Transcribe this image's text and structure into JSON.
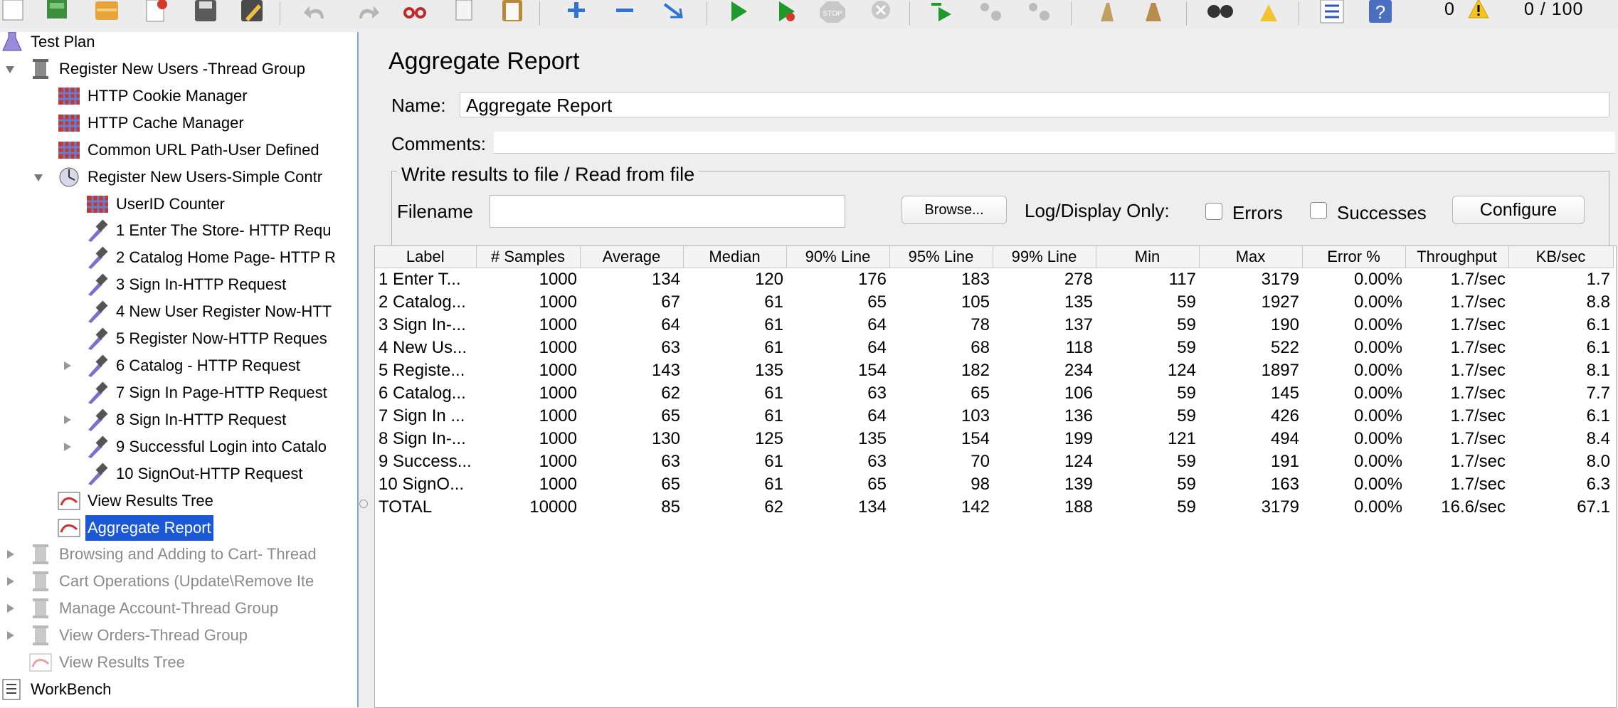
{
  "toolbar": {
    "error_count": "0",
    "thread_status": "0 / 100",
    "buttons": [
      "new-icon",
      "templates-icon",
      "open-icon",
      "close-icon",
      "save-icon",
      "save-as-icon",
      "undo-icon",
      "redo-icon",
      "cut-icon",
      "copy-icon",
      "paste-icon",
      "expand-icon",
      "collapse-icon",
      "toggle-icon",
      "start-icon",
      "start-no-pauses-icon",
      "stop-icon",
      "shutdown-icon",
      "remote-start-icon",
      "remote-stop-icon",
      "remote-shutdown-icon",
      "clear-icon",
      "clear-all-icon",
      "search-icon",
      "reset-search-icon",
      "function-helper-icon",
      "help-icon"
    ]
  },
  "tree": {
    "items": [
      {
        "label": "Test Plan",
        "icon": "test-plan-icon",
        "arrow": "expanded"
      },
      {
        "label": "Register New Users -Thread Group",
        "icon": "thread-group-icon",
        "arrow": "expanded"
      },
      {
        "label": "HTTP Cookie Manager",
        "icon": "config-element-icon"
      },
      {
        "label": "HTTP Cache Manager",
        "icon": "config-element-icon"
      },
      {
        "label": "Common URL Path-User Defined",
        "icon": "config-element-icon"
      },
      {
        "label": "Register New Users-Simple Contr",
        "icon": "controller-icon",
        "arrow": "expanded"
      },
      {
        "label": "UserID Counter",
        "icon": "config-element-icon"
      },
      {
        "label": "1 Enter The Store- HTTP Requ",
        "icon": "sampler-icon"
      },
      {
        "label": "2 Catalog Home Page- HTTP R",
        "icon": "sampler-icon"
      },
      {
        "label": "3 Sign In-HTTP Request",
        "icon": "sampler-icon"
      },
      {
        "label": "4 New User Register Now-HTT",
        "icon": "sampler-icon"
      },
      {
        "label": "5 Register Now-HTTP Reques",
        "icon": "sampler-icon"
      },
      {
        "label": "6 Catalog - HTTP Request",
        "icon": "sampler-icon",
        "arrow": "collapsed"
      },
      {
        "label": "7 Sign In Page-HTTP Request",
        "icon": "sampler-icon"
      },
      {
        "label": "8 Sign In-HTTP Request",
        "icon": "sampler-icon",
        "arrow": "collapsed"
      },
      {
        "label": "9 Successful Login into Catalo",
        "icon": "sampler-icon",
        "arrow": "collapsed"
      },
      {
        "label": "10 SignOut-HTTP Request",
        "icon": "sampler-icon"
      },
      {
        "label": "View Results Tree",
        "icon": "listener-icon"
      },
      {
        "label": "Aggregate Report",
        "icon": "listener-icon",
        "state": "selected"
      },
      {
        "label": "Browsing and Adding to Cart- Thread",
        "icon": "thread-group-icon",
        "arrow": "collapsed",
        "state": "disabled"
      },
      {
        "label": "Cart Operations (Update\\Remove Ite",
        "icon": "thread-group-icon",
        "arrow": "collapsed",
        "state": "disabled"
      },
      {
        "label": "Manage Account-Thread Group",
        "icon": "thread-group-icon",
        "arrow": "collapsed",
        "state": "disabled"
      },
      {
        "label": "View Orders-Thread Group",
        "icon": "thread-group-icon",
        "arrow": "collapsed",
        "state": "disabled"
      },
      {
        "label": "View Results Tree",
        "icon": "listener-icon",
        "state": "disabled"
      },
      {
        "label": "WorkBench",
        "icon": "workbench-icon"
      }
    ]
  },
  "panel": {
    "title": "Aggregate Report",
    "name_label": "Name:",
    "name_value": "Aggregate Report",
    "comments_label": "Comments:",
    "file_section_title": "Write results to file / Read from file",
    "filename_label": "Filename",
    "browse_label": "Browse...",
    "log_display_label": "Log/Display Only:",
    "errors_label": "Errors",
    "successes_label": "Successes",
    "configure_label": "Configure"
  },
  "results": {
    "columns": [
      "Label",
      "# Samples",
      "Average",
      "Median",
      "90% Line",
      "95% Line",
      "99% Line",
      "Min",
      "Max",
      "Error %",
      "Throughput",
      "KB/sec"
    ],
    "rows": [
      [
        "1 Enter T...",
        "1000",
        "134",
        "120",
        "176",
        "183",
        "278",
        "117",
        "3179",
        "0.00%",
        "1.7/sec",
        "1.7"
      ],
      [
        "2 Catalog...",
        "1000",
        "67",
        "61",
        "65",
        "105",
        "135",
        "59",
        "1927",
        "0.00%",
        "1.7/sec",
        "8.8"
      ],
      [
        "3 Sign In-...",
        "1000",
        "64",
        "61",
        "64",
        "78",
        "137",
        "59",
        "190",
        "0.00%",
        "1.7/sec",
        "6.1"
      ],
      [
        "4 New Us...",
        "1000",
        "63",
        "61",
        "64",
        "68",
        "118",
        "59",
        "522",
        "0.00%",
        "1.7/sec",
        "6.1"
      ],
      [
        "5 Registe...",
        "1000",
        "143",
        "135",
        "154",
        "182",
        "234",
        "124",
        "1897",
        "0.00%",
        "1.7/sec",
        "8.1"
      ],
      [
        "6 Catalog...",
        "1000",
        "62",
        "61",
        "63",
        "65",
        "106",
        "59",
        "145",
        "0.00%",
        "1.7/sec",
        "7.7"
      ],
      [
        "7 Sign In ...",
        "1000",
        "65",
        "61",
        "64",
        "103",
        "136",
        "59",
        "426",
        "0.00%",
        "1.7/sec",
        "6.1"
      ],
      [
        "8 Sign In-...",
        "1000",
        "130",
        "125",
        "135",
        "154",
        "199",
        "121",
        "494",
        "0.00%",
        "1.7/sec",
        "8.4"
      ],
      [
        "9 Success...",
        "1000",
        "63",
        "61",
        "63",
        "70",
        "124",
        "59",
        "191",
        "0.00%",
        "1.7/sec",
        "8.0"
      ],
      [
        "10 SignO...",
        "1000",
        "65",
        "61",
        "65",
        "98",
        "139",
        "59",
        "163",
        "0.00%",
        "1.7/sec",
        "6.3"
      ],
      [
        "TOTAL",
        "10000",
        "85",
        "62",
        "134",
        "142",
        "188",
        "59",
        "3179",
        "0.00%",
        "16.6/sec",
        "67.1"
      ]
    ]
  },
  "colors": {
    "selection": "#1a58d6",
    "disabled_text": "#8a8a8a",
    "tree_border": "#7aa7e0",
    "panel_background": "#eeeeee"
  }
}
